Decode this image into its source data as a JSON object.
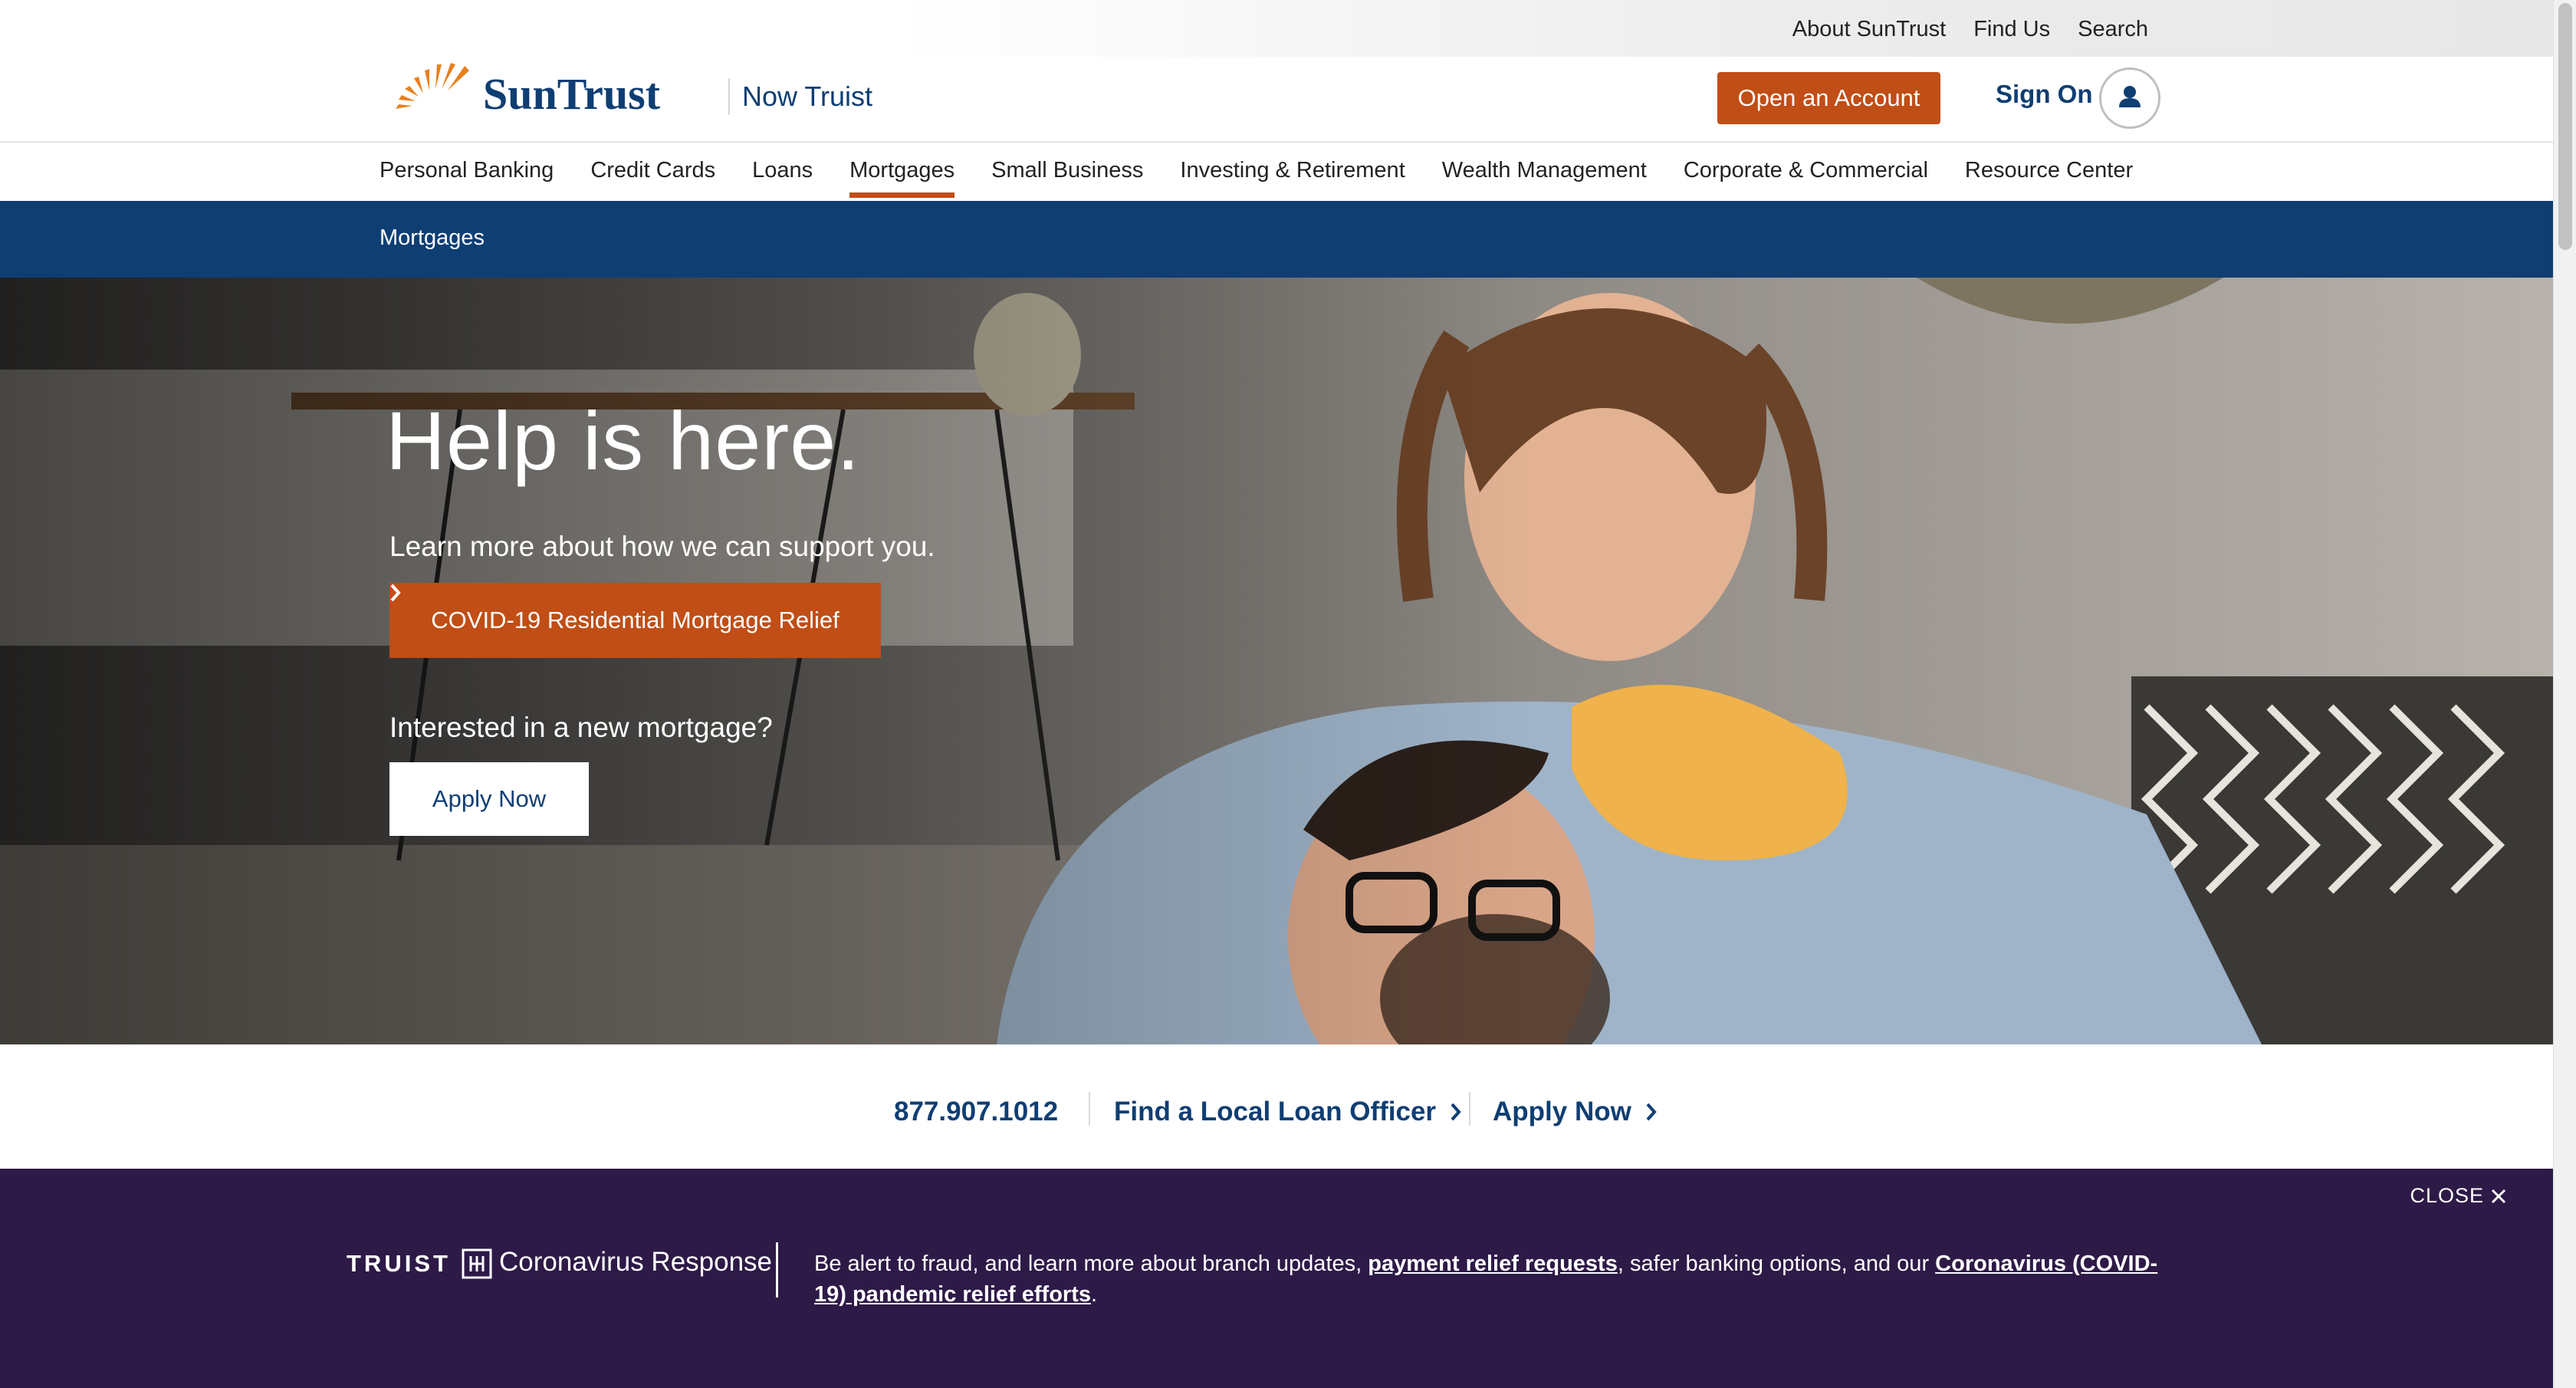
{
  "utility_links": [
    "About SunTrust",
    "Find Us",
    "Search"
  ],
  "brand": {
    "logo_text": "SunTrust",
    "tagline": "Now Truist",
    "primary_color": "#0f3e73",
    "accent_color": "#c04e16"
  },
  "header": {
    "open_account_label": "Open an Account",
    "sign_on_label": "Sign On",
    "user_icon": "user-icon"
  },
  "nav": {
    "items": [
      "Personal Banking",
      "Credit Cards",
      "Loans",
      "Mortgages",
      "Small Business",
      "Investing & Retirement",
      "Wealth Management",
      "Corporate & Commercial",
      "Resource Center"
    ],
    "active": "Mortgages"
  },
  "breadcrumb": {
    "label": "Mortgages"
  },
  "hero": {
    "title": "Help is here.",
    "subtitle": "Learn more about how we can support you.",
    "covid_button_label": "COVID-19 Residential Mortgage Relief",
    "question": "Interested in a new mortgage?",
    "apply_button_label": "Apply Now"
  },
  "cta_row": {
    "phone": "877.907.1012",
    "find_officer_label": "Find a Local Loan Officer",
    "apply_label": "Apply Now"
  },
  "banner": {
    "close_label": "CLOSE",
    "truist_label": "TRUIST",
    "heading": "Coronavirus Response",
    "text_before": "Be alert to fraud, and learn more about branch updates, ",
    "link1": "payment relief requests",
    "text_middle": ", safer banking options, and our ",
    "link2": "Coronavirus (COVID-19) pandemic relief efforts",
    "text_after": ".",
    "background_color": "#2e1a47"
  }
}
